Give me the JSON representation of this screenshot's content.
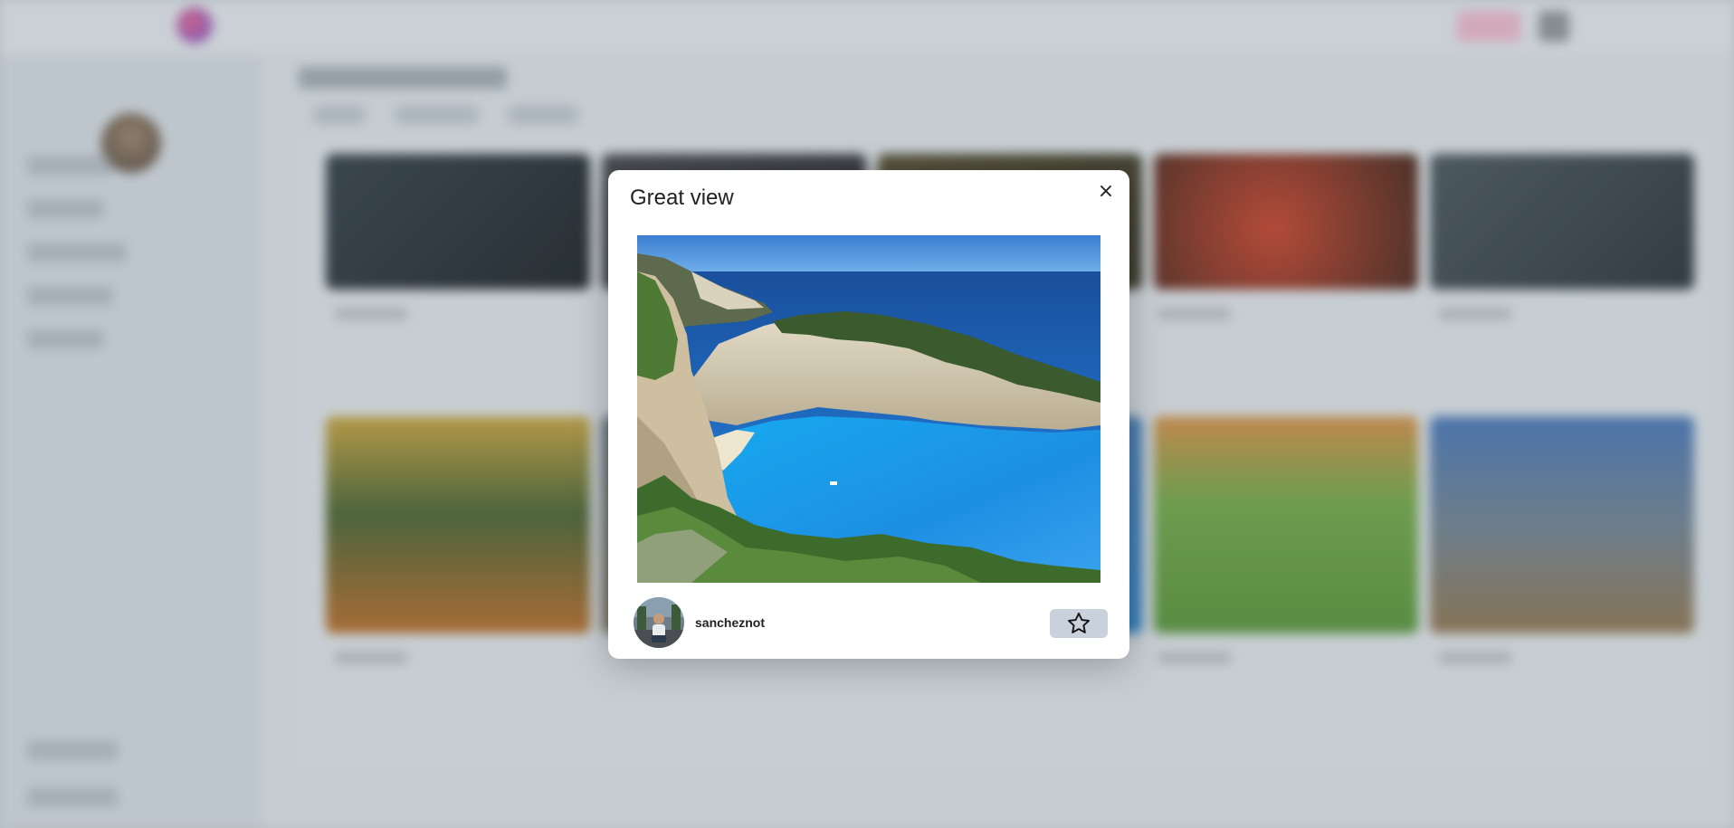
{
  "modal": {
    "title": "Great view",
    "close_label": "×",
    "author": {
      "username": "sancheznot"
    },
    "favorite_icon": "star-outline-icon"
  },
  "colors": {
    "favorite_button_bg": "#c8d1dc",
    "modal_bg": "#ffffff",
    "sea": "#1e9be6",
    "sky": "#2f6fc4"
  }
}
